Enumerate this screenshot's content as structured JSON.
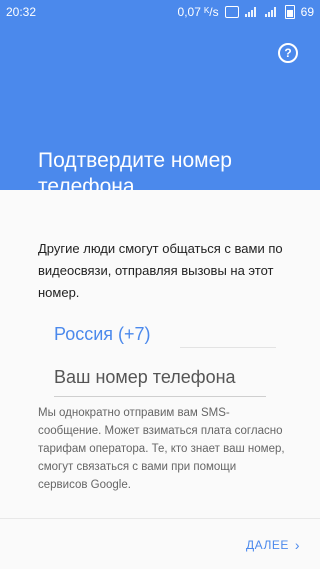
{
  "status": {
    "time": "20:32",
    "speed": "0,07 ᴷ/s",
    "battery": "69"
  },
  "header": {
    "title": "Подтвердите номер телефона",
    "help_icon": "help-icon"
  },
  "body": {
    "description": "Другие люди смогут общаться с вами по видеосвязи, отправляя вызовы на этот номер.",
    "country": "Россия (+7)",
    "phone_placeholder": "Ваш номер телефона",
    "note": "Мы однократно отправим вам SMS-сообщение. Может взиматься плата согласно тарифам оператора. Те, кто знает ваш номер, смогут связаться с вами при помощи сервисов Google."
  },
  "footer": {
    "next_label": "ДАЛЕЕ"
  },
  "colors": {
    "accent": "#4b89ec"
  }
}
